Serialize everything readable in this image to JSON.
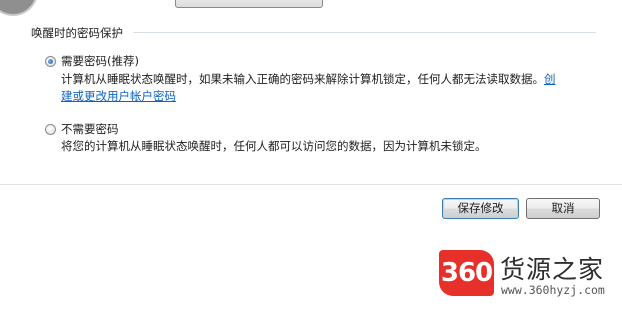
{
  "group": {
    "title": "唤醒时的密码保护"
  },
  "options": [
    {
      "label": "需要密码(推荐)",
      "checked": true,
      "desc_line1": "计算机从睡眠状态唤醒时，如果未输入正确的密码来解除计算机锁定，任何人都无法读取数据。",
      "link_part1": "创",
      "link_part2": "建或更改用户帐户密码"
    },
    {
      "label": "不需要密码",
      "checked": false,
      "desc_line1": "将您的计算机从睡眠状态唤醒时，任何人都可以访问您的数据，因为计算机未锁定。"
    }
  ],
  "buttons": {
    "save": "保存修改",
    "cancel": "取消"
  },
  "watermark": {
    "badge": "360",
    "title": "货源之家",
    "url": "www.360hyzj.com",
    "color": "#e8302a"
  }
}
